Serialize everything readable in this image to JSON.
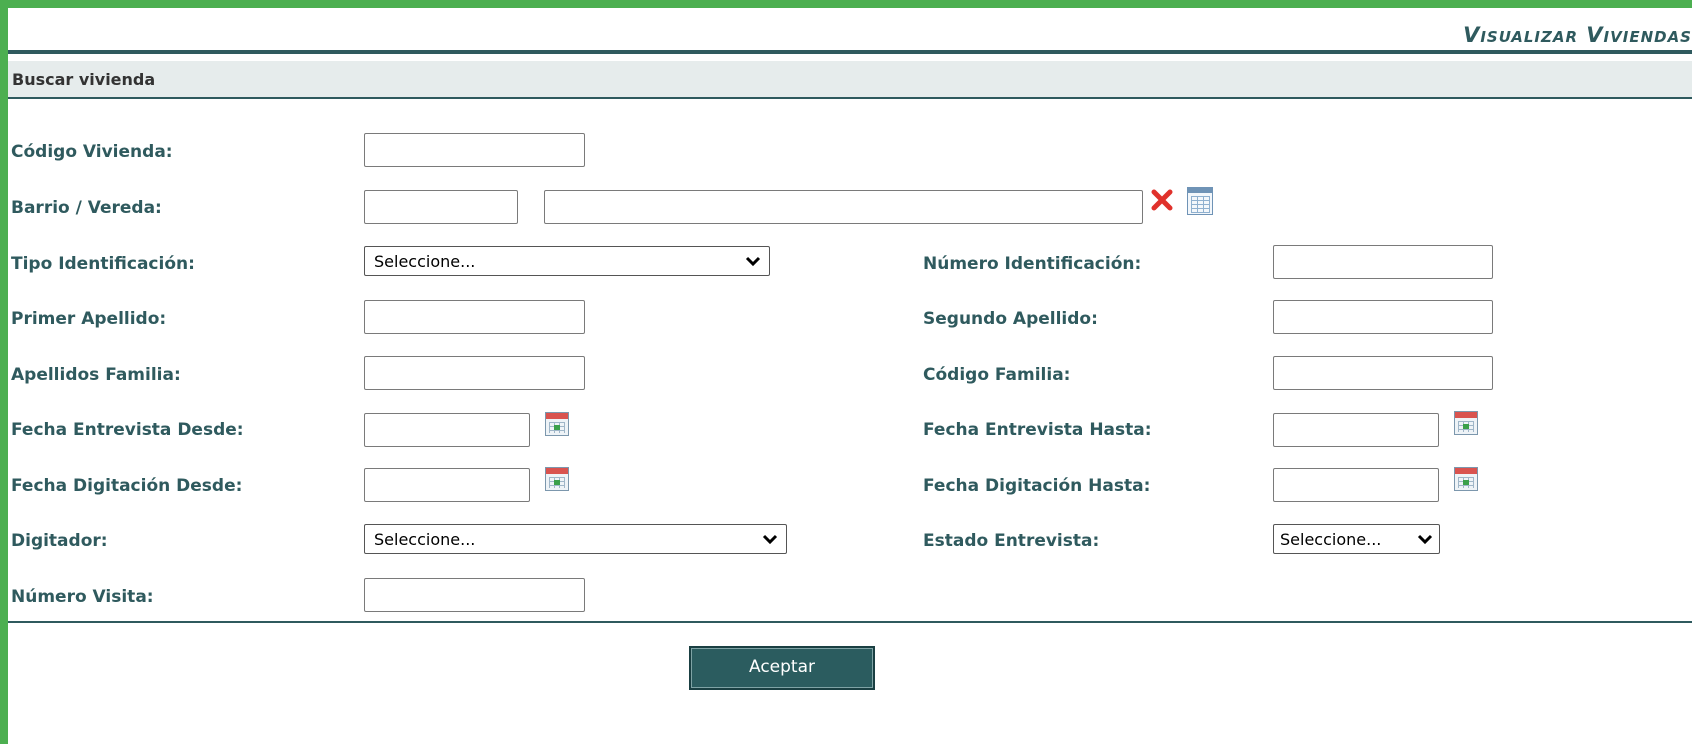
{
  "header": {
    "title": "Visualizar Viviendas"
  },
  "section": {
    "title": "Buscar vivienda"
  },
  "form": {
    "codigo_vivienda": {
      "label": "Código Vivienda:",
      "value": ""
    },
    "barrio_vereda": {
      "label": "Barrio / Vereda:",
      "code_value": "",
      "name_value": ""
    },
    "tipo_identificacion": {
      "label": "Tipo Identificación:",
      "selected": "Seleccione..."
    },
    "numero_identificacion": {
      "label": "Número Identificación:",
      "value": ""
    },
    "primer_apellido": {
      "label": "Primer Apellido:",
      "value": ""
    },
    "segundo_apellido": {
      "label": "Segundo Apellido:",
      "value": ""
    },
    "apellidos_familia": {
      "label": "Apellidos Familia:",
      "value": ""
    },
    "codigo_familia": {
      "label": "Código Familia:",
      "value": ""
    },
    "fecha_entrevista_desde": {
      "label": "Fecha Entrevista Desde:",
      "value": ""
    },
    "fecha_entrevista_hasta": {
      "label": "Fecha Entrevista Hasta:",
      "value": ""
    },
    "fecha_digitacion_desde": {
      "label": "Fecha Digitación Desde:",
      "value": ""
    },
    "fecha_digitacion_hasta": {
      "label": "Fecha Digitación Hasta:",
      "value": ""
    },
    "digitador": {
      "label": "Digitador:",
      "selected": "Seleccione..."
    },
    "estado_entrevista": {
      "label": "Estado Entrevista:",
      "selected": "Seleccione..."
    },
    "numero_visita": {
      "label": "Número Visita:",
      "value": ""
    }
  },
  "icons": {
    "clear": "clear-icon",
    "lookup": "lookup-icon",
    "calendar": "calendar-icon",
    "dropdown": "chevron-down-icon"
  },
  "actions": {
    "accept_label": "Aceptar"
  },
  "colors": {
    "frame": "#4CAF50",
    "accent": "#2f5a5e",
    "section_bg": "#e6ecec",
    "button_bg": "#2b5c5f",
    "clear_icon": "#e0312b"
  }
}
